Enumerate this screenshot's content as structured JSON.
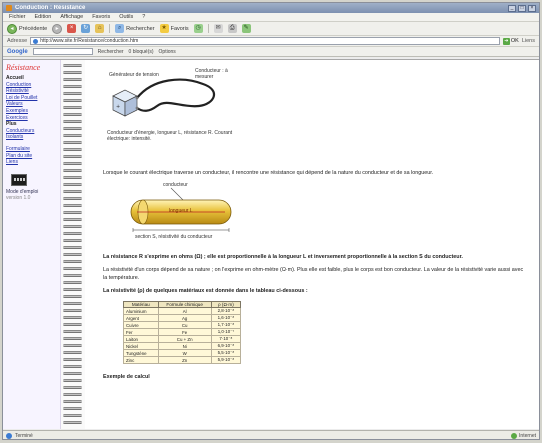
{
  "window": {
    "title": "Conduction : Résistance"
  },
  "menu": [
    "Fichier",
    "Edition",
    "Affichage",
    "Favoris",
    "Outils",
    "?"
  ],
  "toolbar": {
    "back": "Précédente",
    "search": "Rechercher",
    "favorites": "Favoris"
  },
  "address": {
    "label": "Adresse",
    "url": "http://www.site.fr/Resistance/conduction.htm",
    "go": "OK",
    "links": "Liens"
  },
  "googlebar": {
    "brand": "Google",
    "search": "Rechercher",
    "blocked": "0 bloqué(s)",
    "options": "Options"
  },
  "sidebar": {
    "title": "Résistance",
    "items": [
      {
        "label": "Accueil",
        "bold": true
      },
      {
        "label": "Conduction",
        "bold": false
      },
      {
        "label": "Résistivité",
        "bold": false
      },
      {
        "label": "Loi de Pouillet",
        "bold": false
      },
      {
        "label": "Valeurs",
        "bold": false
      },
      {
        "label": "Exemples",
        "bold": false
      },
      {
        "label": "Exercices",
        "bold": false
      },
      {
        "label": "Plus",
        "bold": true
      },
      {
        "label": "Conducteurs",
        "bold": false
      },
      {
        "label": "Isolants",
        "bold": false
      }
    ],
    "items2": [
      "Formulaire",
      "Plan du site",
      "Liens"
    ],
    "kb_caption": "Mode d'emploi",
    "kb_sub": "version 1.0"
  },
  "figure1": {
    "label_generator": "Générateur de tension",
    "label_measure": "Conducteur : à mesurer",
    "caption": "Conducteur d'énergie, longueur L, résistance R. Courant électrique: intensité."
  },
  "para1": "Lorsque le courant électrique traverse un conducteur, il rencontre une résistance qui dépend de la nature du conducteur et de sa longueur.",
  "conductor": {
    "top_label": "conducteur",
    "inner_label": "longueur L",
    "bottom_label": "section S, résistivité du conducteur"
  },
  "para2": "La résistance R s'exprime en ohms (Ω) ; elle est proportionnelle à la longueur L et inversement proportionnelle à la section S du conducteur.",
  "para3": "La résistivité d'un corps dépend de sa nature ; on l'exprime en ohm-mètre (Ω·m). Plus elle est faible, plus le corps est bon conducteur. La valeur de la résistivité varie aussi avec la température.",
  "para4": "La résistivité (ρ) de quelques matériaux est donnée dans le tableau ci-dessous :",
  "table": {
    "headers": [
      "Matériau",
      "Formule chimique",
      "ρ (Ω·m)"
    ],
    "rows": [
      [
        "Aluminium",
        "Al",
        "2,8·10⁻⁸"
      ],
      [
        "Argent",
        "Ag",
        "1,6·10⁻⁸"
      ],
      [
        "Cuivre",
        "Cu",
        "1,7·10⁻⁸"
      ],
      [
        "Fer",
        "Fe",
        "1,0·10⁻⁷"
      ],
      [
        "Laiton",
        "Cu + Zn",
        "7·10⁻⁸"
      ],
      [
        "Nickel",
        "Ni",
        "6,9·10⁻⁸"
      ],
      [
        "Tungstène",
        "W",
        "5,5·10⁻⁸"
      ],
      [
        "Zinc",
        "Zn",
        "5,9·10⁻⁸"
      ]
    ]
  },
  "tail": "Exemple de calcul",
  "status": {
    "text": "Terminé",
    "zone": "Internet"
  },
  "colors": {
    "sidebar_title": "#dd3333",
    "link": "#2233aa",
    "conductor": "#e8c23a",
    "table_bg": "#fff8d8"
  }
}
